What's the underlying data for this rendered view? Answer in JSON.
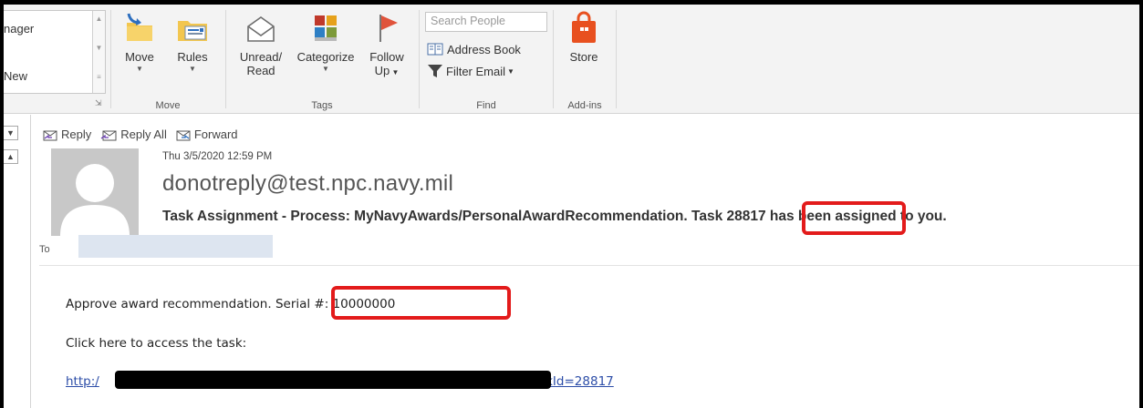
{
  "ribbon": {
    "quick_steps": {
      "item1": "nager",
      "item2": "New"
    },
    "move_group": {
      "label": "Move",
      "move_label": "Move",
      "rules_label": "Rules"
    },
    "tags_group": {
      "label": "Tags",
      "unread_line1": "Unread/",
      "unread_line2": "Read",
      "categorize_label": "Categorize",
      "follow_line1": "Follow",
      "follow_line2": "Up"
    },
    "find_group": {
      "label": "Find",
      "search_placeholder": "Search People",
      "address_book": "Address Book",
      "filter_email": "Filter Email"
    },
    "addins_group": {
      "label": "Add-ins",
      "store_label": "Store"
    }
  },
  "message": {
    "actions": {
      "reply": "Reply",
      "reply_all": "Reply All",
      "forward": "Forward"
    },
    "date": "Thu 3/5/2020 12:59 PM",
    "sender": "donotreply@test.npc.navy.mil",
    "subject_before": "Task Assignment - Process: MyNavyAwards/PersonalAwardRecommendation.",
    "subject_task": "Task 28817",
    "subject_after": " has been assigned to you.",
    "to_label": "To",
    "body": {
      "line1_before": "Approve award recommendation.",
      "line1_serial": "Serial #: 10000000",
      "line2": "Click here to access the task:",
      "link_start": "http:/",
      "link_end": "askId=28817"
    }
  },
  "colors": {
    "callout": "#e31b1b",
    "link": "#2d4ea8",
    "redaction": "#000000"
  },
  "icons": [
    "move-folder-icon",
    "rules-icon",
    "envelope-icon",
    "categorize-icon",
    "follow-up-flag-icon",
    "address-book-icon",
    "filter-icon",
    "store-icon",
    "reply-icon",
    "reply-all-icon",
    "forward-icon",
    "avatar-icon"
  ]
}
